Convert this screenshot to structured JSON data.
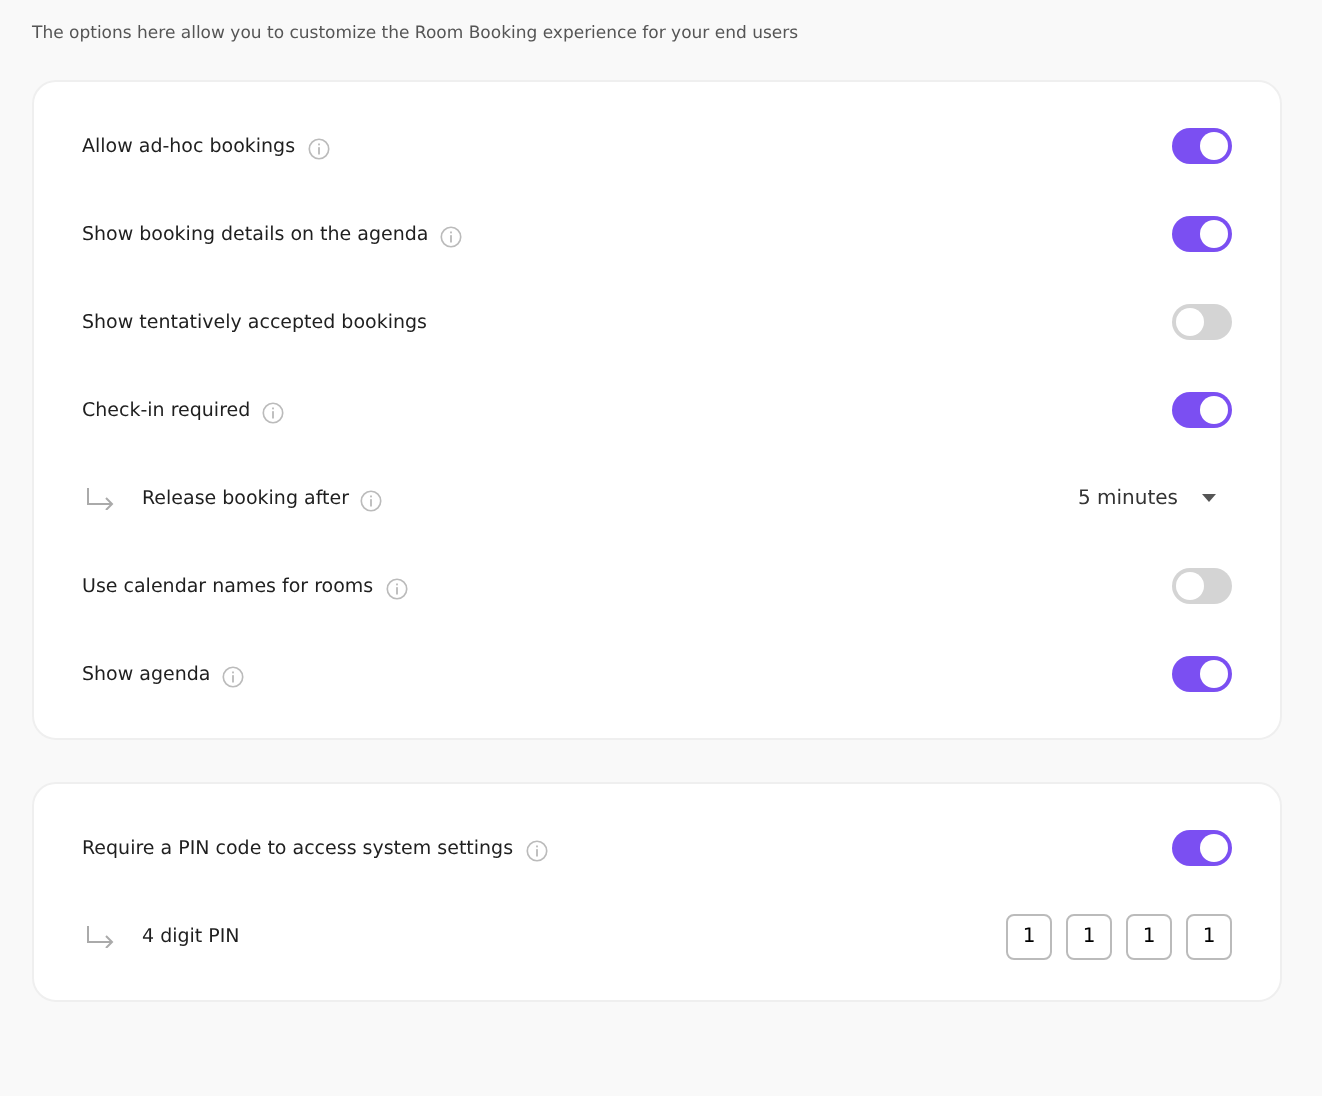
{
  "intro": "The options here allow you to customize the Room Booking experience for your end users",
  "cards": [
    {
      "rows": [
        {
          "kind": "toggle",
          "label": "Allow ad-hoc bookings",
          "info": true,
          "on": true
        },
        {
          "kind": "toggle",
          "label": "Show booking details on the agenda",
          "info": true,
          "on": true
        },
        {
          "kind": "toggle",
          "label": "Show tentatively accepted bookings",
          "info": false,
          "on": false
        },
        {
          "kind": "toggle",
          "label": "Check-in required",
          "info": true,
          "on": true
        },
        {
          "kind": "select",
          "label": "Release booking after",
          "info": true,
          "value": "5 minutes"
        },
        {
          "kind": "toggle",
          "label": "Use calendar names for rooms",
          "info": true,
          "on": false
        },
        {
          "kind": "toggle",
          "label": "Show agenda",
          "info": true,
          "on": true
        }
      ]
    },
    {
      "rows": [
        {
          "kind": "toggle",
          "label": "Require a PIN code to access system settings",
          "info": true,
          "on": true
        },
        {
          "kind": "pin",
          "label": "4 digit PIN",
          "info": false,
          "digits": [
            "1",
            "1",
            "1",
            "1"
          ]
        }
      ]
    }
  ]
}
